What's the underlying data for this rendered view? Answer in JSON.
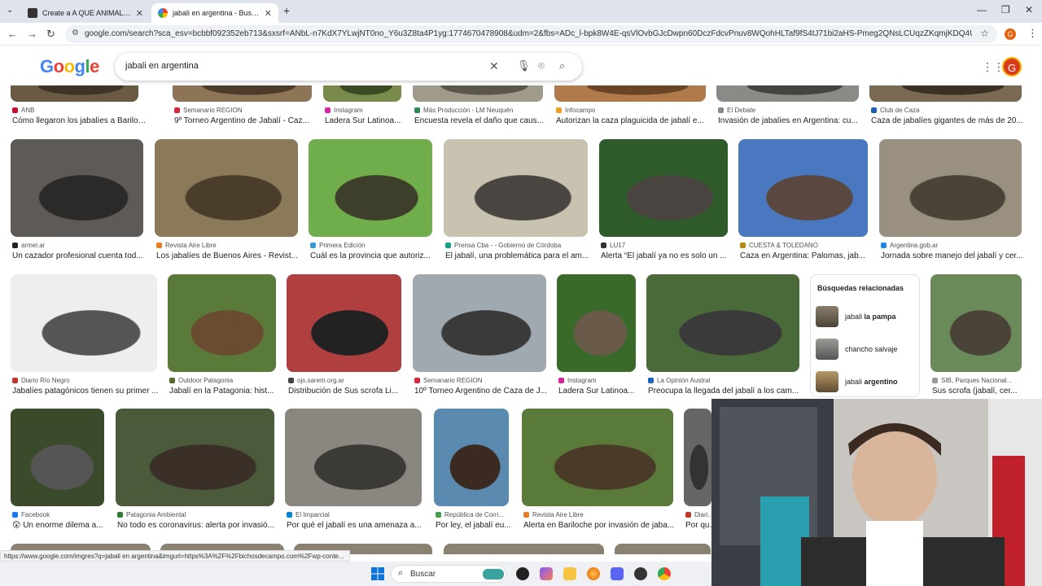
{
  "browser": {
    "tabs": [
      {
        "title": "Create a A QUE ANIMAL LE GA...",
        "active": false
      },
      {
        "title": "jabali en argentina - Buscar con...",
        "active": true
      }
    ],
    "new_tab": "+",
    "url": "google.com/search?sca_esv=bcbbf092352eb713&sxsrf=ANbL-n7KdX7YLwjNT0no_Y6u3Z8ta4P1yg:1774670478908&udm=2&fbs=ADc_l-bpk8W4E-qsVlOvbGJcDwpn60DczFdcvPnuv8WQohHLTaf9fS4tJ71bi2aHS-Pmeg2QNsLCUqzZKqmjKDQ4UhxYzdKnlhH1z86lwDU...",
    "profile_initial": "G"
  },
  "google": {
    "logo": "Google",
    "query": "jabali en argentina",
    "avatar_initial": "G"
  },
  "results": {
    "row0": [
      {
        "source": "ANB",
        "title": "Cómo llegaron los jabalíes a Bariloche ...",
        "fav": "#c8102e"
      },
      {
        "source": "Semanario REGION",
        "title": "9º Torneo Argentino de Jabalí - Caz...",
        "fav": "#d62a3c"
      },
      {
        "source": "Instagram",
        "title": "Ladera Sur Latinoa...",
        "fav": "#d6249f"
      },
      {
        "source": "Más Producción - LM Neuquén",
        "title": "Encuesta revela el daño que caus...",
        "fav": "#2e8b57"
      },
      {
        "source": "Infocampo",
        "title": "Autorizan la caza plaguicida de jabalí e...",
        "fav": "#f0a020"
      },
      {
        "source": "El Debate",
        "title": "Invasión de jabalíes en Argentina: cu...",
        "fav": "#888888"
      },
      {
        "source": "Club de Caza",
        "title": "Caza de jabalíes gigantes de más de 20...",
        "fav": "#1a5fb4"
      }
    ],
    "row1": [
      {
        "source": "armel.ar",
        "title": "Un cazador profesional cuenta tod...",
        "fav": "#222222"
      },
      {
        "source": "Revista Aire Libre",
        "title": "Los jabalíes de Buenos Aires - Revist...",
        "fav": "#e67e22"
      },
      {
        "source": "Primera Edición",
        "title": "Cuál es la provincia que autoriz...",
        "fav": "#3498db"
      },
      {
        "source": "Prensa Cba - - Gobierno de Córdoba",
        "title": "El jabalí, una problemática para el am...",
        "fav": "#16a085"
      },
      {
        "source": "LU17",
        "title": "Alerta “El jabalí ya no es solo un ...",
        "fav": "#333333"
      },
      {
        "source": "CUESTA & TOLEDANO",
        "title": "Caza en Argentina: Palomas, jab...",
        "fav": "#b8860b"
      },
      {
        "source": "Argentina.gob.ar",
        "title": "Jornada sobre manejo del jabalí y cer...",
        "fav": "#1e88e5"
      }
    ],
    "row2": [
      {
        "source": "Diario Río Negro",
        "title": "Jabalíes patagónicos tienen su primer ...",
        "fav": "#c0392b"
      },
      {
        "source": "Outdoor Patagonia",
        "title": "Jabalí en la Patagonia: hist...",
        "fav": "#556b2f"
      },
      {
        "source": "ojs.sarem.org.ar",
        "title": "Distribución de Sus scrofa Li...",
        "fav": "#444444"
      },
      {
        "source": "Semanario REGION",
        "title": "10º Torneo Argentino de Caza de J...",
        "fav": "#d62a3c"
      },
      {
        "source": "Instagram",
        "title": "Ladera Sur Latinoa...",
        "fav": "#d6249f"
      },
      {
        "source": "La Opinión Austral",
        "title": "Preocupa la llegada del jabalí a los cam...",
        "fav": "#1565c0"
      },
      {
        "source": "SIB, Parques Nacional...",
        "title": "Sus scrofa (jabalí, cer...",
        "fav": "#999999"
      }
    ],
    "row3": [
      {
        "source": "Facebook",
        "title": "😲 Un enorme dilema a...",
        "fav": "#1877f2"
      },
      {
        "source": "Patagonia Ambiental",
        "title": "No todo es coronavirus: alerta por invasió...",
        "fav": "#2e7d32"
      },
      {
        "source": "El Imparcial",
        "title": "Por qué el jabalí es una amenaza a...",
        "fav": "#0288d1"
      },
      {
        "source": "República de Corri...",
        "title": "Por ley, el jabalí eu...",
        "fav": "#43a047"
      },
      {
        "source": "Revista Aire Libre",
        "title": "Alerta en Bariloche por invasión de jaba...",
        "fav": "#e67e22"
      },
      {
        "source": "Diari...",
        "title": "Por qu...",
        "fav": "#c0392b"
      }
    ]
  },
  "related": {
    "heading": "Búsquedas relacionadas",
    "items": [
      {
        "plain": "jabali ",
        "bold": "la pampa"
      },
      {
        "plain": "chancho salvaje",
        "bold": ""
      },
      {
        "plain": "jabali ",
        "bold": "argentino"
      }
    ]
  },
  "status_url": "https://www.google.com/imgres?q=jabali en argentina&imgurl=https%3A%2F%2Fbichosdecampo.com%2Fwp-conte...",
  "taskbar": {
    "search_label": "Buscar"
  }
}
